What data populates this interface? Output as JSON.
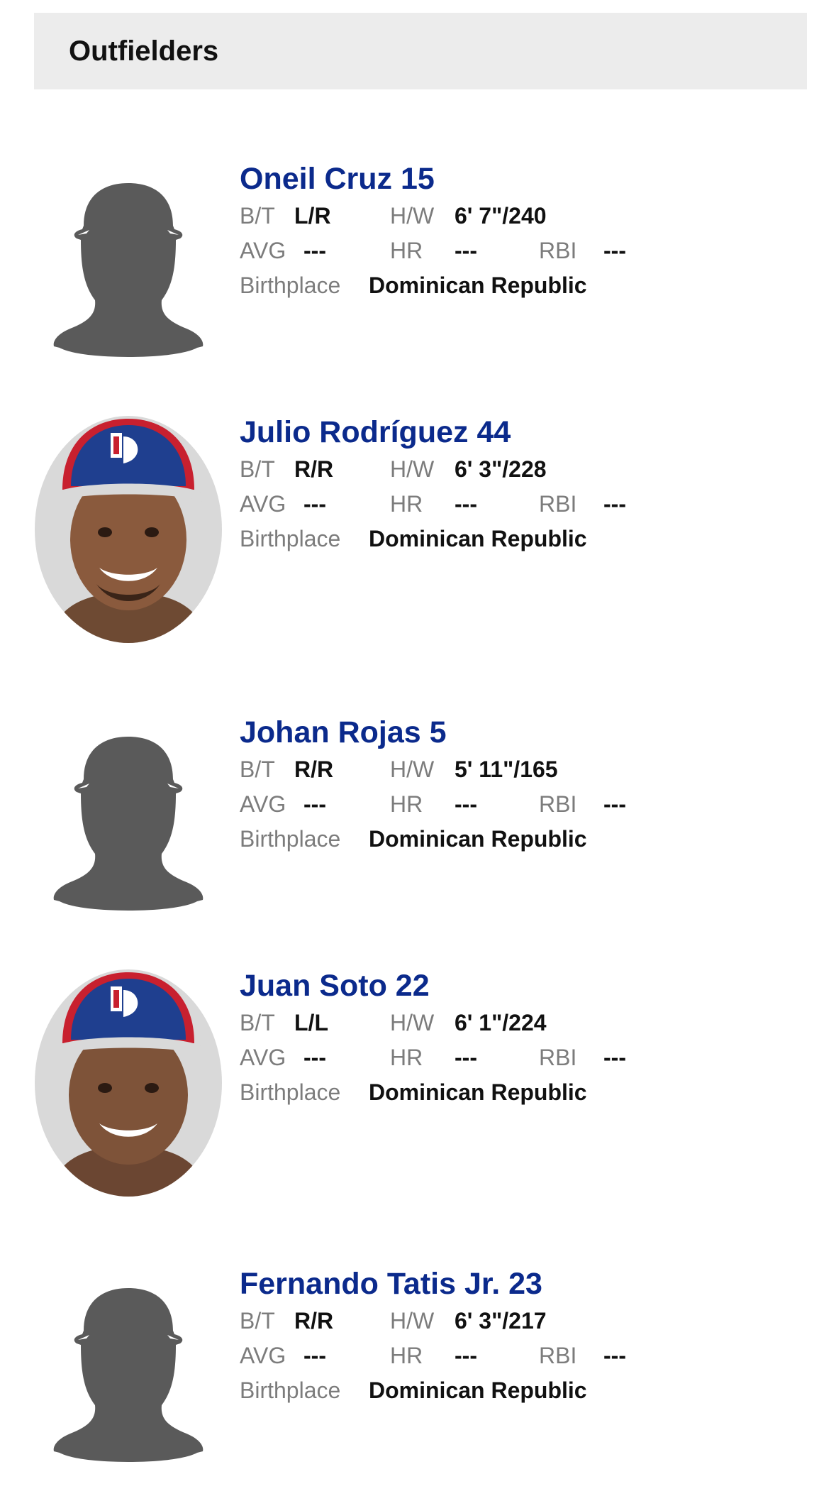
{
  "section": {
    "title": "Outfielders"
  },
  "labels": {
    "bt": "B/T",
    "hw": "H/W",
    "avg": "AVG",
    "hr": "HR",
    "rbi": "RBI",
    "birthplace": "Birthplace"
  },
  "players": [
    {
      "name": "Oneil Cruz 15",
      "bt": "L/R",
      "hw": "6' 7\"/240",
      "avg": "---",
      "hr": "---",
      "rbi": "---",
      "birthplace": "Dominican Republic",
      "photo": "silhouette-placeholder-icon"
    },
    {
      "name": "Julio Rodríguez 44",
      "bt": "R/R",
      "hw": "6' 3\"/228",
      "avg": "---",
      "hr": "---",
      "rbi": "---",
      "birthplace": "Dominican Republic",
      "photo": "player-headshot"
    },
    {
      "name": "Johan Rojas 5",
      "bt": "R/R",
      "hw": "5' 11\"/165",
      "avg": "---",
      "hr": "---",
      "rbi": "---",
      "birthplace": "Dominican Republic",
      "photo": "silhouette-placeholder-icon"
    },
    {
      "name": "Juan Soto 22",
      "bt": "L/L",
      "hw": "6' 1\"/224",
      "avg": "---",
      "hr": "---",
      "rbi": "---",
      "birthplace": "Dominican Republic",
      "photo": "player-headshot"
    },
    {
      "name": "Fernando Tatis Jr. 23",
      "bt": "R/R",
      "hw": "6' 3\"/217",
      "avg": "---",
      "hr": "---",
      "rbi": "---",
      "birthplace": "Dominican Republic",
      "photo": "silhouette-placeholder-icon"
    }
  ],
  "colors": {
    "name_link": "#0b2a8c",
    "label": "#7c7c7c",
    "header_bg": "#ececec",
    "silhouette": "#5a5a5a",
    "cap_blue": "#1f3f8f",
    "cap_red": "#c8202f"
  }
}
